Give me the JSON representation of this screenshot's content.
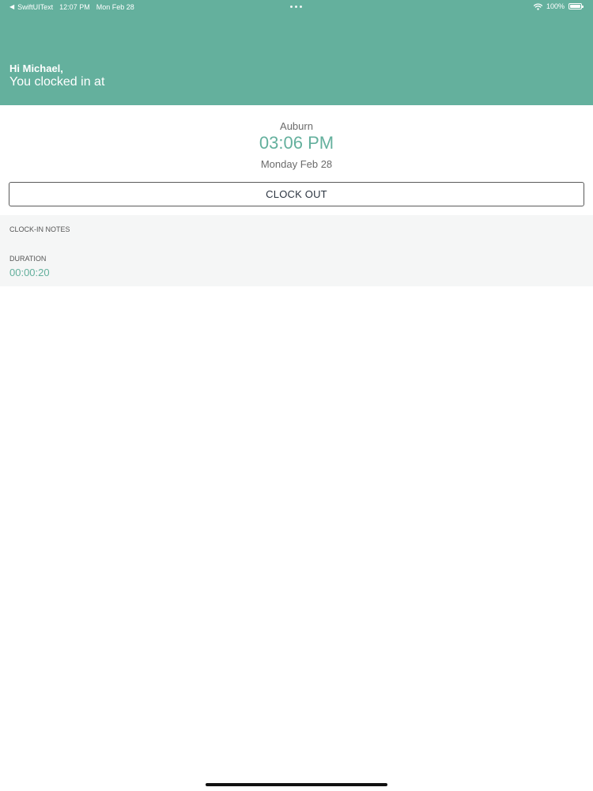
{
  "status_bar": {
    "back_arrow": "◀",
    "app_name": "SwiftUIText",
    "time": "12:07 PM",
    "date": "Mon Feb 28",
    "battery_percent": "100%",
    "icons": [
      "wifi-icon",
      "battery-icon"
    ]
  },
  "header": {
    "greeting": "Hi Michael,",
    "subtitle": "You clocked in at"
  },
  "clock_in": {
    "location": "Auburn",
    "time": "03:06 PM",
    "date": "Monday Feb 28"
  },
  "actions": {
    "clock_out_label": "CLOCK OUT"
  },
  "details": {
    "notes_label": "CLOCK-IN NOTES",
    "duration_label": "DURATION",
    "duration_value": "00:00:20"
  },
  "colors": {
    "accent": "#64b09d",
    "text_dark": "#2b3440",
    "text_muted": "#6b6b6b",
    "section_bg": "#f5f6f6"
  }
}
